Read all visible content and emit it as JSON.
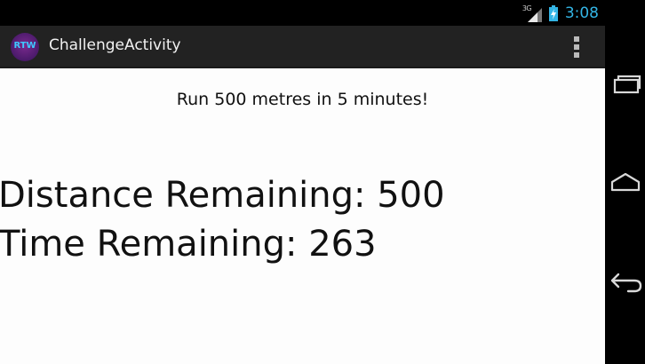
{
  "status_bar": {
    "network_type": "3G",
    "time": "3:08",
    "icons": [
      "signal-icon",
      "battery-icon"
    ]
  },
  "action_bar": {
    "logo_text": "RTW",
    "title": "ChallengeActivity",
    "overflow_icon": "overflow-menu-icon"
  },
  "content": {
    "challenge": "Run 500 metres in 5 minutes!",
    "distance_label": "Distance Remaining: ",
    "distance_value": "500",
    "time_label": "Time Remaining: ",
    "time_value": "263"
  },
  "nav_bar": {
    "buttons": [
      "recents-icon",
      "home-icon",
      "back-icon"
    ]
  },
  "colors": {
    "clock": "#33b5e5",
    "action_bar": "#222222",
    "content_bg": "#fdfdfd",
    "logo_text": "#3fc7ff"
  }
}
